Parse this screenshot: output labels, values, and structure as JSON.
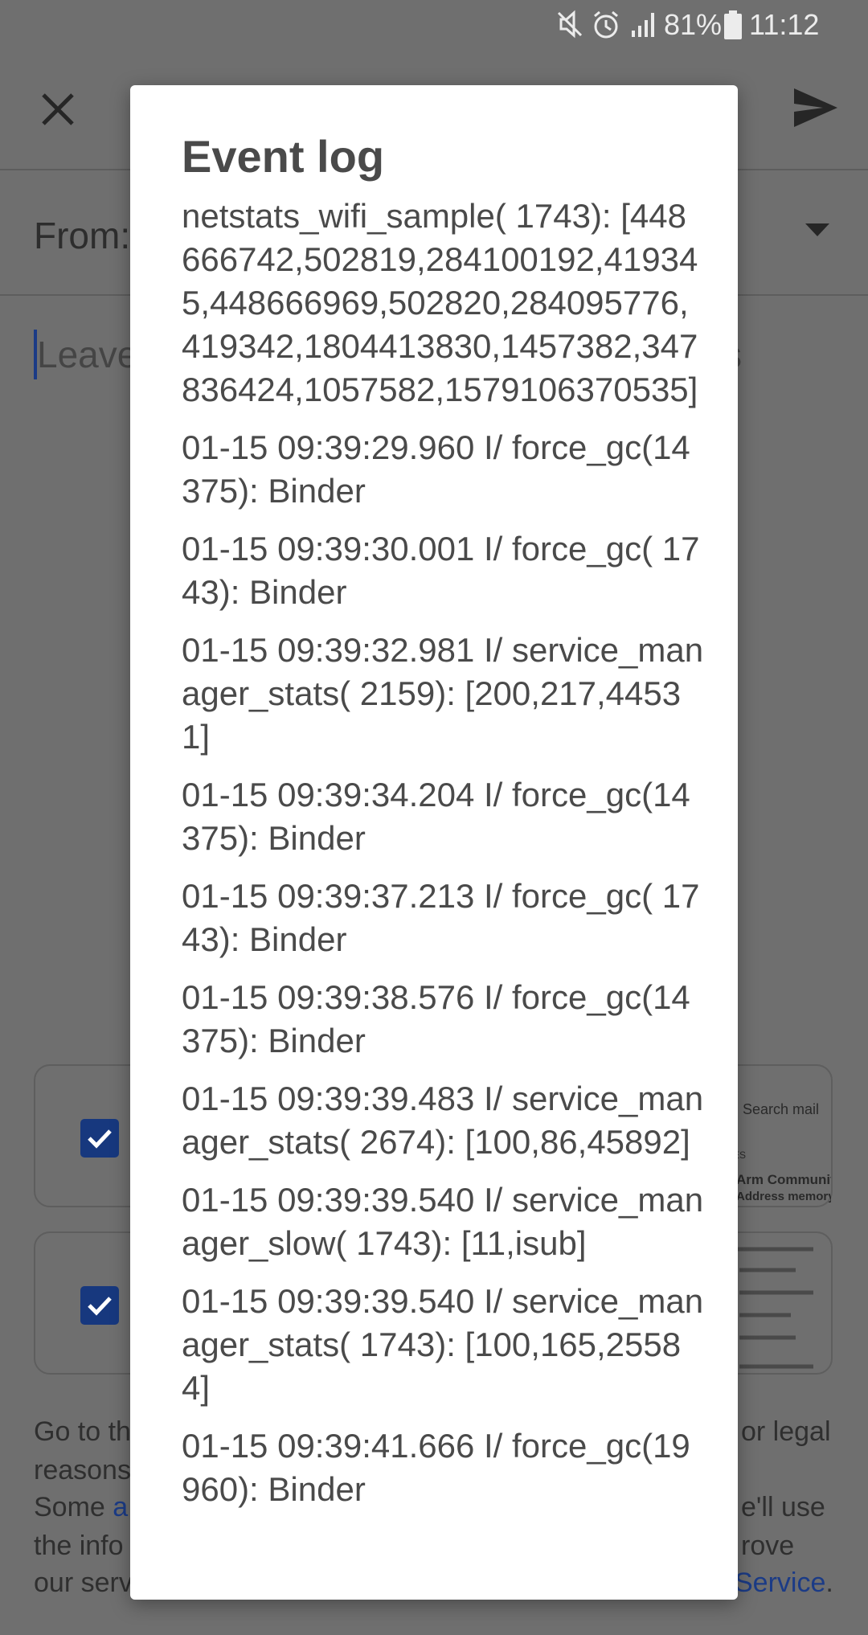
{
  "status_bar": {
    "battery": "81%",
    "time": "11:12",
    "icons": [
      "mute-icon",
      "alarm-icon",
      "signal-icon",
      "battery-icon"
    ]
  },
  "compose": {
    "from_label": "From:",
    "body_placeholder_visible": "Leave",
    "body_fragment_right": "s",
    "footer": {
      "line1_left": "Go to th",
      "line1_right": "or legal",
      "line2_left": "reasons",
      "line3_left": "Some",
      "line3_link": "a",
      "line3_right": "e'll use",
      "line4_left": "the info",
      "line4_right": "rove",
      "line5_left": "our serv",
      "line5_link": "Service",
      "line5_period": "."
    },
    "card1_preview": {
      "search": "Search mail",
      "tag": "ES",
      "title": "Arm Communit",
      "subtitle": "Address memory"
    }
  },
  "dialog": {
    "title": "Event log",
    "entries": [
      {
        "text": "netstats_wifi_sample( 1743): [448666742,502819,284100192,419345,448666969,502820,284095776,419342,1804413830,1457382,347836424,1057582,1579106370535]"
      },
      {
        "text": "01-15 09:39:29.960 I/ force_gc(14375): Binder"
      },
      {
        "text": "01-15 09:39:30.001 I/ force_gc( 1743): Binder"
      },
      {
        "text": "01-15 09:39:32.981 I/ service_manager_stats( 2159): [200,217,44531]"
      },
      {
        "text": "01-15 09:39:34.204 I/ force_gc(14375): Binder"
      },
      {
        "text": "01-15 09:39:37.213 I/ force_gc( 1743): Binder"
      },
      {
        "text": "01-15 09:39:38.576 I/ force_gc(14375): Binder"
      },
      {
        "text": "01-15 09:39:39.483 I/ service_manager_stats( 2674): [100,86,45892]"
      },
      {
        "text": "01-15 09:39:39.540 I/ service_manager_slow( 1743): [11,isub]"
      },
      {
        "text": "01-15 09:39:39.540 I/ service_manager_stats( 1743): [100,165,25584]"
      },
      {
        "text": "01-15 09:39:41.666 I/ force_gc(19960): Binder"
      }
    ]
  },
  "colors": {
    "scrim": "#6f6f6f",
    "dialog_bg": "#ffffff",
    "text": "#4a4a4a",
    "accent": "#1b3b86"
  }
}
